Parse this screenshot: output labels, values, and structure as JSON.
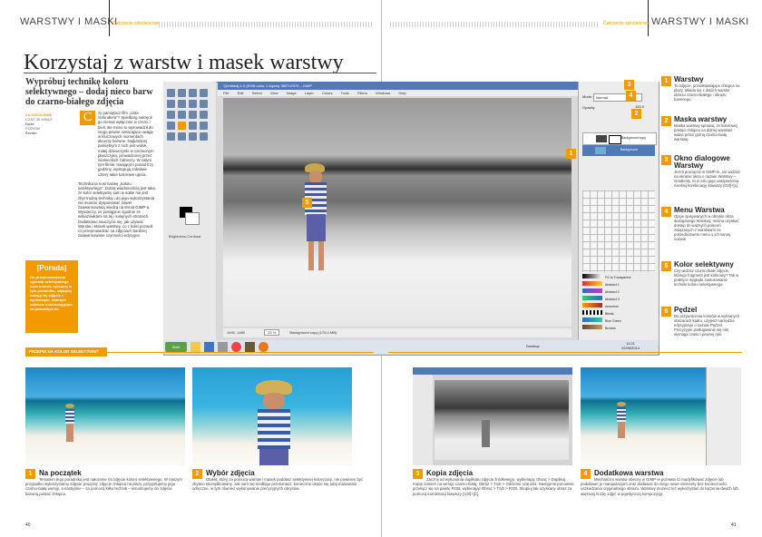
{
  "header": {
    "left_title": "WARSTWY I MASKI",
    "tag_left": "Ćwiczenie szkoleniowe",
    "tag_right": "Ćwiczenie szkoleniowe",
    "right_title": "WARSTWY I MASKI"
  },
  "article": {
    "title": "Korzystaj z warstw i masek warstwy",
    "subtitle": "Wypróbuj technikę koloru selektywnego – dodaj nieco barw do czarno-białego zdjęcia",
    "meta_lines": [
      "ZA SZKOLENIE",
      "CZAS 30 MINUT",
      "Dość",
      "POZIOM",
      "Średni"
    ],
    "dropcap": "C",
    "intro": "zy pamiętacz film „Lista Schindlera”? Spielberg nakręcił go niemal wyłącznie w czerni i bieli, ale mimo to wprowadził do niego pewne zwracające uwagę w kluczowych momentach akcenty barwne. Najbardziej pamiętnym z nich jest widok małej dziewczynki w czerwonym płaszczyku, prowadzonej przez niemieckich żołnierzy. W całym tym filmie, trwającym ponad trzy godziny, występują zaledwie cztery takie kolorowe ujęcia.",
    "body": "Technika ta nosi nazwę „koloru selektywnego”. Dobrą wiadomością jest taka, że kolor selektywny sam w sobie nie jest zbyt trudną techniką i do jego wykorzystania nie musicie dysponować nawet zaawansowaną wiedzą na temat GIMP-a. Wystarczy, że postąpicie zgodnie ze wskazówkami na tej i kolejnych stronach. Dodatkowo nauczycie się, jak używać Warstw i Masek warstwy, co z kolei pozwoli Ci przeprowadzać na zdjęciach bardziej zaawansowane czynności edycyjne.",
    "tip_title": "[Porada]",
    "tip_body": "Do przeprowadzenia operacji selektywnego kolorowania, opisanej w tym poradniku, najlepiej nadają się zdjęcia o wyrazistym, zwartym obiekcie kontrastującym na jednolitym tle."
  },
  "screenshot": {
    "window_title": "*[Untitled]-1.0 (RGB color, 2 layers) 3807x2570 – GIMP",
    "menu": [
      "File",
      "Edit",
      "Select",
      "View",
      "Image",
      "Layer",
      "Colors",
      "Tools",
      "Filters",
      "Windows",
      "Help"
    ],
    "status_left": "1440, 1480",
    "zoom": "33 %",
    "status_right": "Background copy (175.4 MB)",
    "taskbar_start": "Start",
    "clock_time": "11:21",
    "clock_date": "22/06/2014",
    "desktop_label": "Desktop",
    "toolbox_label": "Brightness-Contrast",
    "layers_panel": {
      "mode_label": "Mode:",
      "mode_value": "Normal",
      "opacity_label": "Opacity",
      "opacity_value": "100.0",
      "layer1": "Background copy",
      "layer2": "Background"
    },
    "gradients": [
      "FG to Transparent",
      "Abstract 1",
      "Abstract 2",
      "Abstract 3",
      "Aneurism",
      "Blinds",
      "Blue Green",
      "Browns"
    ],
    "markers": [
      "1",
      "2",
      "3",
      "4",
      "5"
    ]
  },
  "sidebar": [
    {
      "num": "1",
      "title": "Warstwy",
      "text": "To zdjęcie, przedstawiające chłopca na plaży, składa się z dwóch warstw: obrazu czarno-białego i obrazu barwnego."
    },
    {
      "num": "2",
      "title": "Maska warstwy",
      "text": "Maska warstwy sprawia, że kolorowej postaci chłopca na dolnej warstwie widać przez górną czarno-białą warstwę."
    },
    {
      "num": "3",
      "title": "Okno dialogowe Warstwy",
      "text": "Jeżeli pracujesz w GIMP-ie, nie widzisz na ekranie okna o nazwie Warstwy – Gradienty, to w celu jego uaktywnienia naciśnij kombinację klawiszy [Ctrl]+[L]."
    },
    {
      "num": "4",
      "title": "Menu Warstwa",
      "text": "Opcje opisywanych w obrębie okna dialogowego Warstwy, można uzyskać dostęp do ważnych poleceń związanych z warstwami za pośrednictwem menu u ich samej nazwie."
    },
    {
      "num": "5",
      "title": "Kolor selektywny",
      "text": "Czy widzisz czarno-białe zdjęcie, którego fragment jest kolorowy? Tak w praktyce wygląda zastosowanie techniki koloru selektywnego."
    },
    {
      "num": "6",
      "title": "Pędzel",
      "text": "Do przywrócenia kolorów w wybranych obszarach kadru, użyjesz narzędzia edycyjnego o nazwie Pędzel. Precyzyjne posługiwanie się nim wymaga czasu i pewnej ręki."
    }
  ],
  "section_label": "PRZEPIS NA KOLOR SELEKTYWNY",
  "steps": [
    {
      "num": "1",
      "title": "Na początek",
      "text": "Tematem tego poradnika jest nałożenie na zdjęcie koloru selektywnego. W naszym przypadku wykorzystamy zdjęcie powyżej: zdjęcie chłopca na plaży, przygotujemy jego czarno-białą wersję, a następnie – za pomocą kilku technik – wmontujemy do zdjęcia barwną postać chłopca."
    },
    {
      "num": "2",
      "title": "Wybór zdjęcia",
      "text": "Obiekt, który za pomocą warstw i masek poddasz selektywnej koloryzacji, nie powinien być zbytnio skomplikowany. Jak sam się niedługo przekonasz, konieczne okaże się tutaj malowanie odręczne, w tym również wykonywanie precyzyjnych obrysów."
    },
    {
      "num": "3",
      "title": "Kopia zdjęcia",
      "text": "Zacznij od wykonania duplikatu zdjęcia źródłowego, wybierając Obraz > Duplikuj. Kopię zamień na wersję czarno-białą: Obraz > Tryb > Odcienie szarości. Następnie ponownie przełącz się na paletę RGB, wybierając Obraz > Tryb > RGB. Skopiuj tak uzyskany obraz za pomocą kombinacji klawiszy [Ctrl]+[C]."
    },
    {
      "num": "4",
      "title": "Dodatkowa warstwa",
      "text": "Mechanizm warstw obecny w GIMP-ie pozwala Ci modyfikować zdjęcie lub poddawać je manipulacjom oraz dodawać do niego nowe elementy bez konieczności uszkadzania oryginalnego obrazu. Warstwy możesz też wykorzystać do łączenia dwóch lub większej liczby zdjęć w pojedynczą kompozycję."
    }
  ],
  "page_numbers": {
    "left": "40",
    "right": "41"
  },
  "colors": {
    "accent": "#f39a00",
    "gimp_title": "#4f79b7"
  }
}
